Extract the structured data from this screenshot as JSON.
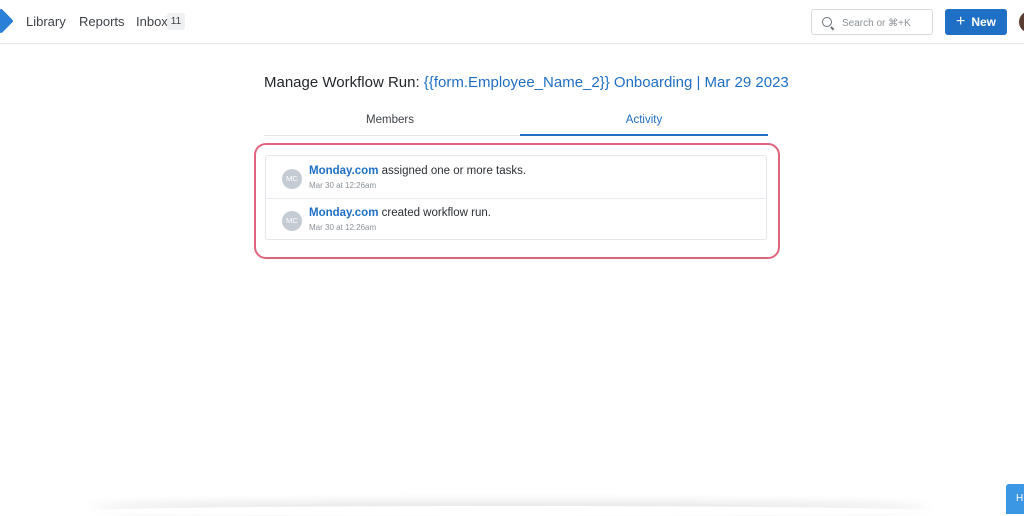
{
  "nav": {
    "items": [
      {
        "label": "Library"
      },
      {
        "label": "Reports"
      },
      {
        "label": "Inbox",
        "badge": "11"
      }
    ],
    "search": {
      "placeholder": "Search or ⌘+K",
      "value": ""
    },
    "new_button": {
      "label": "New",
      "icon": "plus-icon"
    }
  },
  "header": {
    "title_prefix": "Manage Workflow Run:",
    "run_name": "{{form.Employee_Name_2}} Onboarding | Mar 29 2023"
  },
  "tabs": [
    {
      "label": "Members",
      "active": false
    },
    {
      "label": "Activity",
      "active": true
    }
  ],
  "activity": [
    {
      "avatar": "MC",
      "actor": "Monday.com",
      "text": " assigned one or more tasks.",
      "time": "Mar 30 at 12:26am"
    },
    {
      "avatar": "MC",
      "actor": "Monday.com",
      "text": " created workflow run.",
      "time": "Mar 30 at 12:26am"
    }
  ],
  "help": {
    "label": "H"
  },
  "colors": {
    "accent": "#1f6fc4",
    "highlight": "#e0647e",
    "avatar_bg": "#c4cbd3"
  }
}
